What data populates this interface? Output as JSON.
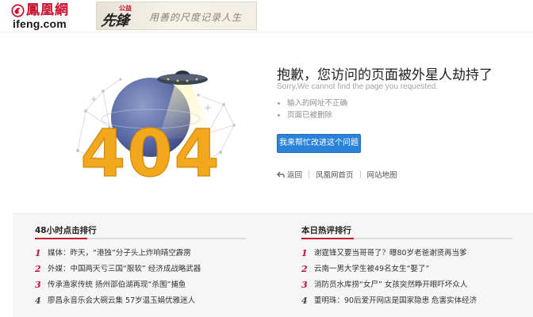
{
  "header": {
    "logo_cn": "鳳凰網",
    "logo_en": "ifeng.com",
    "banner": {
      "badge_top": "公益",
      "badge_main": "先锋",
      "slogan": "用善的尺度记录人生"
    }
  },
  "illustration": {
    "digits": "404"
  },
  "error": {
    "title": "抱歉，您访问的页面被外星人劫持了",
    "subtitle": "Sorry,We cannot find the page you requested.",
    "reasons": [
      "输入的网址不正确",
      "页面已被删除"
    ],
    "help_button": "我来帮忙改进这个问题",
    "links": {
      "back": "返回",
      "home": "凤凰网首页",
      "sitemap": "网站地图"
    }
  },
  "panel": {
    "left": {
      "title": "48小时点击排行",
      "items": [
        {
          "num": "1",
          "text": "媒体：昨天，“港独”分子头上炸响晴空霹雳"
        },
        {
          "num": "2",
          "text": "外媒：中国两天亏三国“服软” 经济成战略武器"
        },
        {
          "num": "3",
          "text": "传承渔家传统 扬州邵伯湖再现“杀围”捕鱼"
        },
        {
          "num": "4",
          "text": "廖昌永音乐会大碗云集 57岁温玉娟优雅迷人"
        }
      ]
    },
    "right": {
      "title": "本日热评排行",
      "items": [
        {
          "num": "1",
          "text": "谢霆锋又要当哥哥了？曝80岁老爸谢贤再当爹"
        },
        {
          "num": "2",
          "text": "云南一男大学生被49名女生“娶了”"
        },
        {
          "num": "3",
          "text": "消防员水库捞“女尸” 女孩突然睁开眼吓坏众人"
        },
        {
          "num": "4",
          "text": "董明珠：90后爱开网店是国家隐患 危害实体经济"
        }
      ]
    }
  },
  "colors": {
    "brand_red": "#c8102e",
    "button_blue": "#2a83d8",
    "digits_orange": "#f2a81d"
  }
}
